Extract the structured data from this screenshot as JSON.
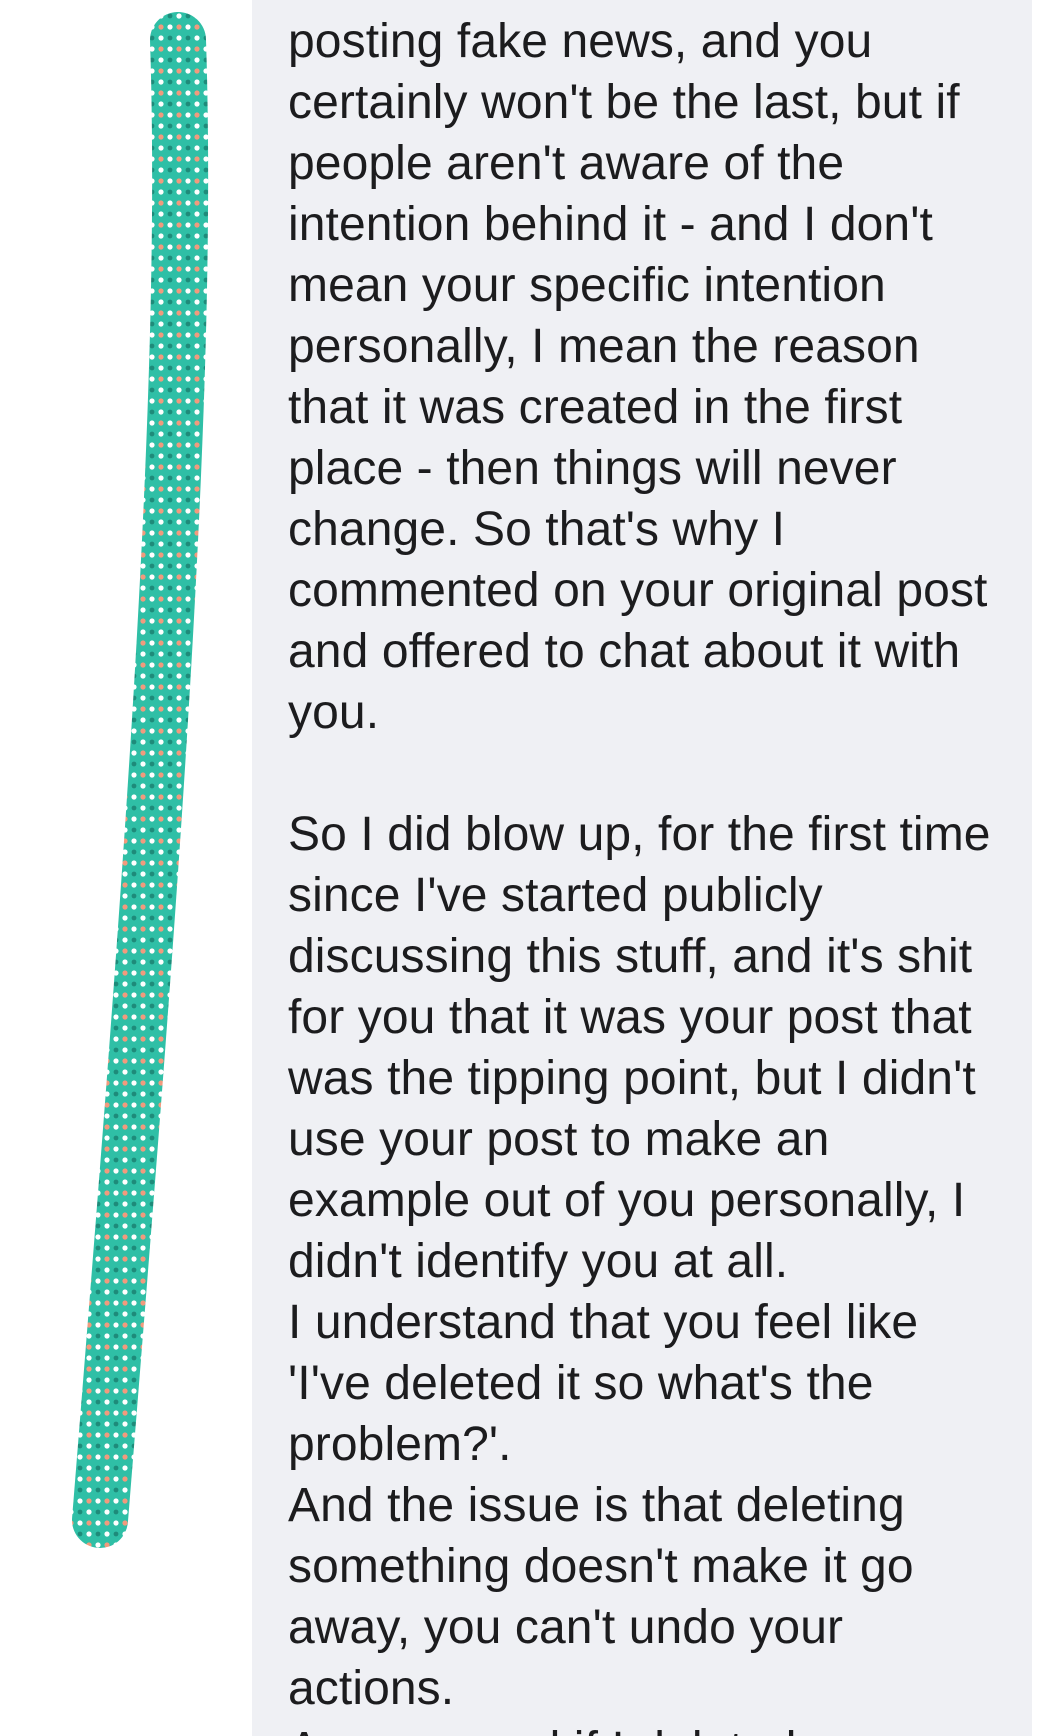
{
  "message": {
    "paragraph_1": [
      "posting fake news, and you",
      "certainly won't be the last, but if",
      "people aren't aware of the",
      "intention behind it - and I don't",
      "mean your specific intention",
      "personally, I mean the reason",
      "that it was created in the first",
      "place - then things will never",
      "change. So that's why I",
      "commented on your original post",
      "and offered to chat about it with",
      "you."
    ],
    "paragraph_2": [
      "So I did blow up, for the first time",
      "since I've started publicly",
      "discussing this stuff, and it's shit",
      "for you that it was your post that",
      "was the tipping point, but I didn't",
      "use your post to make an",
      "example out of you personally, I",
      "didn't identify you at all.",
      "I understand that you feel like",
      "'I've deleted it so what's the",
      "problem?'.",
      "And the issue is that deleting",
      "something doesn't make it go",
      "away, you can't undo your",
      "actions."
    ],
    "partial_last_line": "Anyway, and if I deleted"
  },
  "colors": {
    "bubble_background": "#eff0f4",
    "text": "#1c1c1e",
    "scribble_teal": "#2fbfa6",
    "scribble_dot_white": "#ffffff",
    "scribble_dot_salmon": "#f29a7d",
    "scribble_dot_dark": "#1e8b7a"
  }
}
